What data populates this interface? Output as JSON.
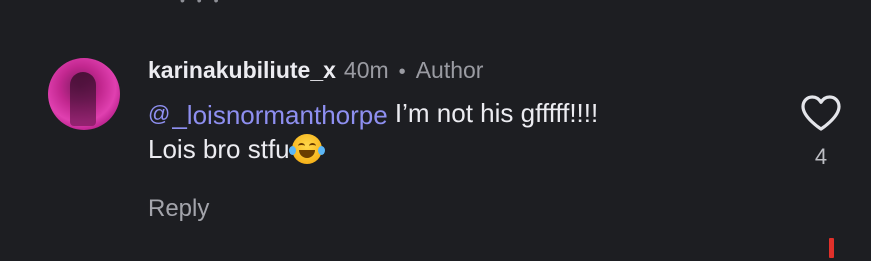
{
  "comment": {
    "username": "karinakubiliute_x",
    "time": "40m",
    "separator": "•",
    "role": "Author",
    "mention": "_loisnormanthorpe",
    "mention_icon": "threads-icon",
    "line1_text": " I’m not his gfffff!!!!",
    "line2_text": "Lois bro stfu",
    "emoji": "face-with-tears-of-joy",
    "reply_label": "Reply",
    "like_count": "4"
  },
  "colors": {
    "background": "#1d1e22",
    "mention": "#8e8ff0",
    "meta": "#9a9ba2"
  }
}
